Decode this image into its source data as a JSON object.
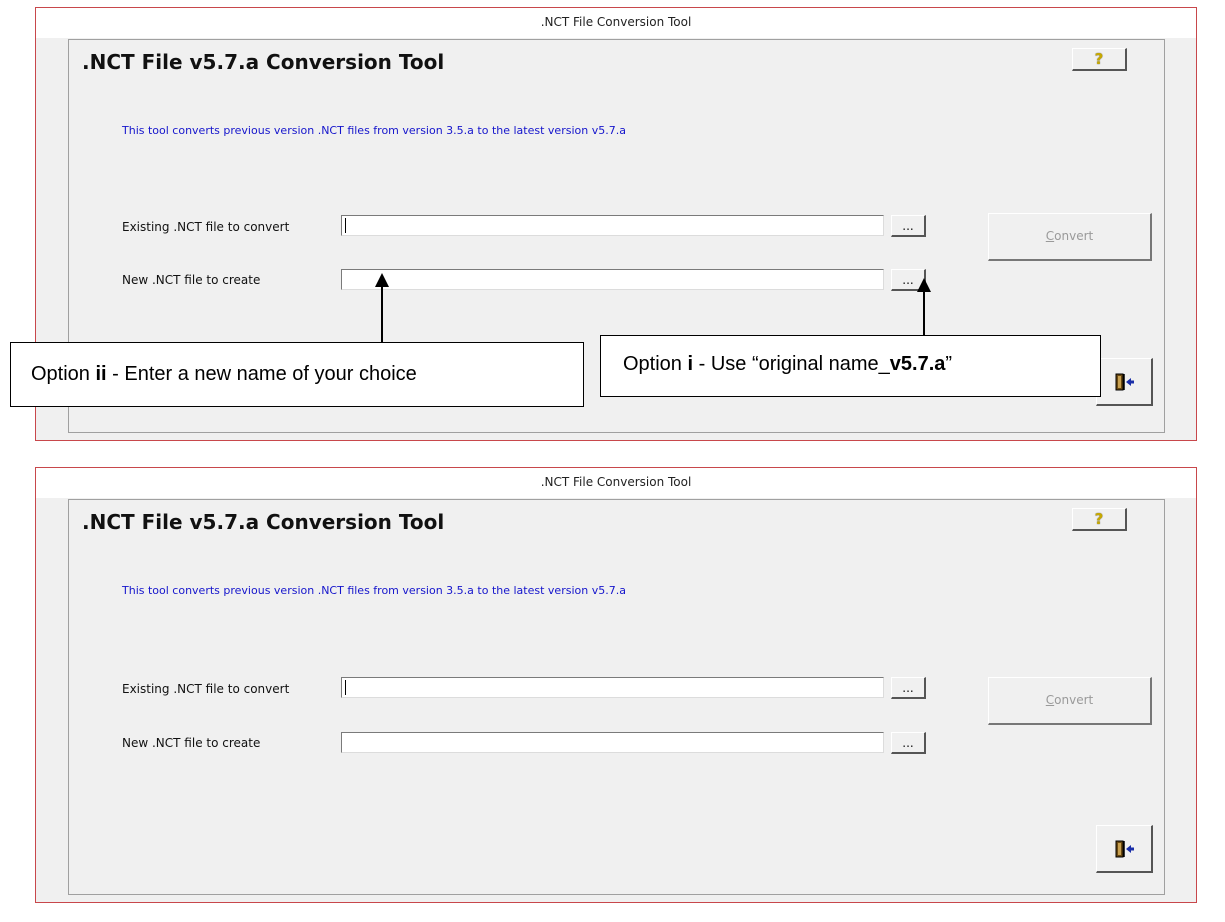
{
  "windows": [
    {
      "title": ".NCT File Conversion Tool",
      "heading": ".NCT File v5.7.a Conversion Tool",
      "help_glyph": "?",
      "info": "This tool converts previous version .NCT files from version 3.5.a to the latest version v5.7.a",
      "existing_label": "Existing .NCT file to convert",
      "existing_value": "",
      "new_label": "New .NCT file to create",
      "new_value": "",
      "browse_label": "...",
      "convert_hotkey": "C",
      "convert_rest": "onvert",
      "exit_icon": "exit-door-icon"
    },
    {
      "title": ".NCT File Conversion Tool",
      "heading": ".NCT File v5.7.a Conversion Tool",
      "help_glyph": "?",
      "info": "This tool converts previous version .NCT files from version 3.5.a to the latest version v5.7.a",
      "existing_label": "Existing .NCT file to convert",
      "existing_value": "",
      "new_label": "New .NCT file to create",
      "new_value": "",
      "browse_label": "...",
      "convert_hotkey": "C",
      "convert_rest": "onvert",
      "exit_icon": "exit-door-icon"
    }
  ],
  "annotations": {
    "option_ii": {
      "prefix": "Option ",
      "bold": "ii",
      "suffix": " - Enter a new name of your choice"
    },
    "option_i": {
      "prefix": "Option ",
      "bold": "i",
      "middle": " - Use “original name_",
      "bold_suffix": "v5.7.a",
      "close": "”"
    }
  },
  "colors": {
    "window_border": "#c8474b",
    "info_text": "#1515cc",
    "help_icon": "#c6a800",
    "disabled_text": "#9a9a9a"
  }
}
